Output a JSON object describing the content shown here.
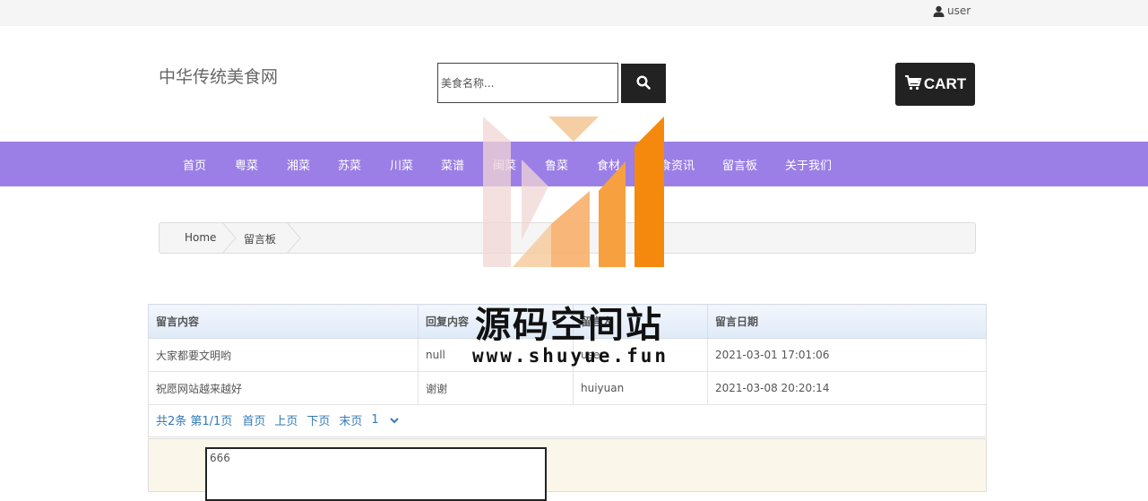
{
  "topbar": {
    "user_label": "user"
  },
  "header": {
    "site_title": "中华传统美食网",
    "search_placeholder": "美食名称...",
    "cart_label": "CART"
  },
  "nav": {
    "items": [
      "首页",
      "粤菜",
      "湘菜",
      "苏菜",
      "川菜",
      "菜谱",
      "闽菜",
      "鲁菜",
      "食材",
      "美食资讯",
      "留言板",
      "关于我们"
    ]
  },
  "breadcrumb": {
    "home": "Home",
    "current": "留言板"
  },
  "table": {
    "headers": [
      "留言内容",
      "回复内容",
      "留言人",
      "留言日期"
    ],
    "rows": [
      [
        "大家都要文明哟",
        "null",
        "user",
        "2021-03-01 17:01:06"
      ],
      [
        "祝愿网站越来越好",
        "谢谢",
        "huiyuan",
        "2021-03-08 20:20:14"
      ]
    ]
  },
  "pager": {
    "info": "共2条 第1/1页",
    "first": "首页",
    "prev": "上页",
    "next": "下页",
    "last": "末页",
    "page_select": "1"
  },
  "reply": {
    "value": "666"
  },
  "watermark": {
    "title": "源码空间站",
    "url": "www.shuyue.fun"
  },
  "colors": {
    "nav_bg": "#9b7fe6",
    "dark_button": "#222222",
    "link": "#337ab7"
  },
  "icons": {
    "user": "user-icon",
    "search": "search-icon",
    "cart": "cart-icon",
    "dropdown": "chevron-down-icon"
  }
}
